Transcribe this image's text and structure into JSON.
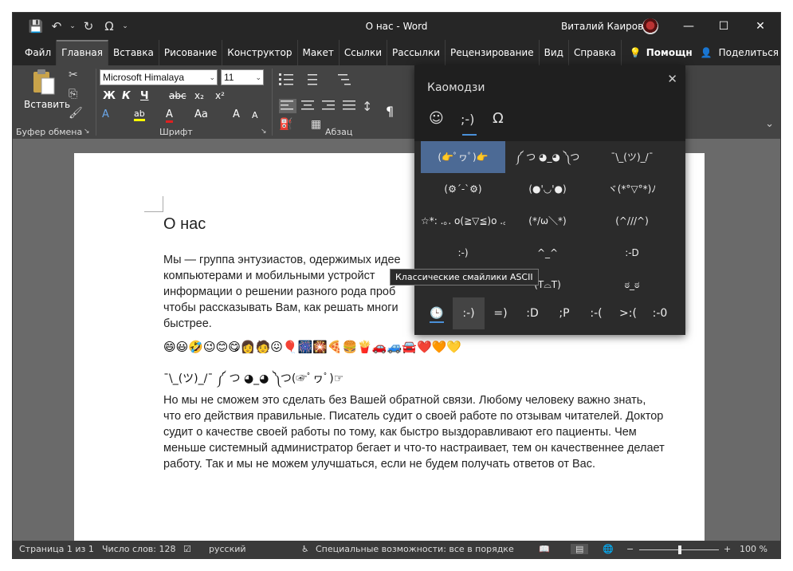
{
  "titlebar": {
    "title": "О нас  -  Word",
    "user": "Виталий Каиров",
    "qat": {
      "save": "💾",
      "undo": "↶",
      "undo_dd": "⌄",
      "redo": "↻",
      "omega": "Ω",
      "more": "⌄"
    },
    "minimize": "—",
    "maximize": "☐",
    "close": "✕"
  },
  "tabs": [
    "Файл",
    "Главная",
    "Вставка",
    "Рисование",
    "Конструктор",
    "Макет",
    "Ссылки",
    "Рассылки",
    "Рецензирование",
    "Вид",
    "Справка"
  ],
  "tabs_right": {
    "lamp": "💡",
    "help": "Помощн",
    "share_icon": "👤",
    "share": "Поделиться",
    "smiley": "☺"
  },
  "ribbon": {
    "paste_label": "Вставить",
    "clipboard_label": "Буфер обмена",
    "font_label": "Шрифт",
    "paragraph_label": "Абзац",
    "font_name": "Microsoft Himalaya",
    "font_size": "11",
    "bold": "Ж",
    "italic": "К",
    "underline": "Ч",
    "strike": "abc",
    "sub": "x₂",
    "sup": "x²",
    "grow": "A",
    "shrink": "A",
    "aa": "Aa",
    "pilcrow": "¶",
    "expand": "↘",
    "cut": "✂",
    "copy": "⎘",
    "painter": "🖌",
    "text_effects": "A",
    "highlight": "ab",
    "font_color": "A",
    "clear_format": "A",
    "dd": "⌄",
    "chevron": "⌄"
  },
  "document": {
    "heading": "О нас",
    "para1": "Мы — группа энтузиастов, одержимых идее компьютерами и мобильными устройст информации о решении разного рода проб чтобы рассказывать Вам, как решать многи быстрее.",
    "emoji_row": "😄😃🤣😉😊😋👩🧑😖🎈🎆🎇🍕🍔🍟🚗🚙🚘❤️🧡💛",
    "kaomoji_line": "¯\\_(ツ)_/¯ ༼ つ ◕_◕ ༽つ(☞ﾟヮﾟ)☞",
    "para2": "Но мы не сможем это сделать без Вашей обратной связи. Любому человеку важно знать, что его действия правильные. Писатель судит о своей работе по отзывам читателей. Доктор судит о качестве своей работы по тому, как быстро выздоравливают его пациенты. Чем меньше системный администратор бегает и что-то настраивает, тем он качественнее делает работу. Так и мы не можем улучшаться, если не будем получать ответов от Вас."
  },
  "status": {
    "page": "Страница 1 из 1",
    "words": "Число слов: 128",
    "proof_icon": "☑",
    "language": "русский",
    "accessibility_icon": "♿",
    "accessibility": "Специальные возможности: все в порядке",
    "read_icon": "📖",
    "print_icon": "▤",
    "web_icon": "🌐",
    "zoom_out": "−",
    "zoom_in": "+",
    "zoom": "100 %",
    "zoom_level": 0.5
  },
  "panel": {
    "title": "Каомодзи",
    "close": "✕",
    "tab_emoji": "☺",
    "tab_kaomoji": ";-)",
    "tab_symbols": "Ω",
    "kaomoji": [
      "(👉ﾟヮﾟ)👉",
      "༼ つ ◕_◕ ༽つ",
      "¯\\_(ツ)_/¯",
      "(⚙´-`⚙)",
      "(●'◡'●)",
      "ヾ(*°▽°*)ﾉ",
      "☆*: .｡. o(≧▽≦)o .｡.:*☆",
      "(*/ω＼*)",
      "(^///^)",
      ":-)",
      "^_^",
      ":-D",
      "",
      "(T⌓T)",
      "ಠ_ಠ"
    ],
    "tooltip": "Классические смайлики ASCII",
    "categories": [
      "🕒",
      ":-)",
      "=)",
      ":D",
      ";P",
      ":-(",
      ">:(",
      ":-0"
    ]
  }
}
